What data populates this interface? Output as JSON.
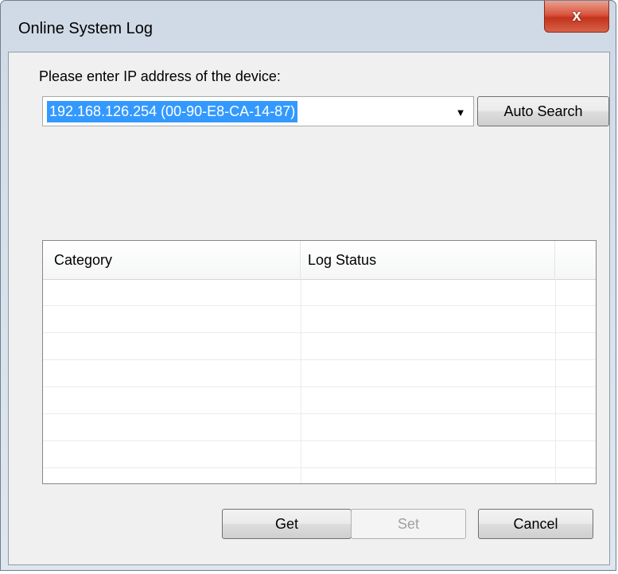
{
  "window": {
    "title": "Online System Log",
    "close_glyph": "x"
  },
  "device": {
    "prompt": "Please enter IP address of the device:",
    "selected_ip": "192.168.126.254 (00-90-E8-CA-14-87)",
    "dropdown_icon": "chevron-down-icon",
    "auto_search_label": "Auto Search"
  },
  "log_table": {
    "columns": [
      "Category",
      "Log Status",
      ""
    ],
    "rows": []
  },
  "buttons": {
    "get_label": "Get",
    "set_label": "Set",
    "cancel_label": "Cancel"
  }
}
